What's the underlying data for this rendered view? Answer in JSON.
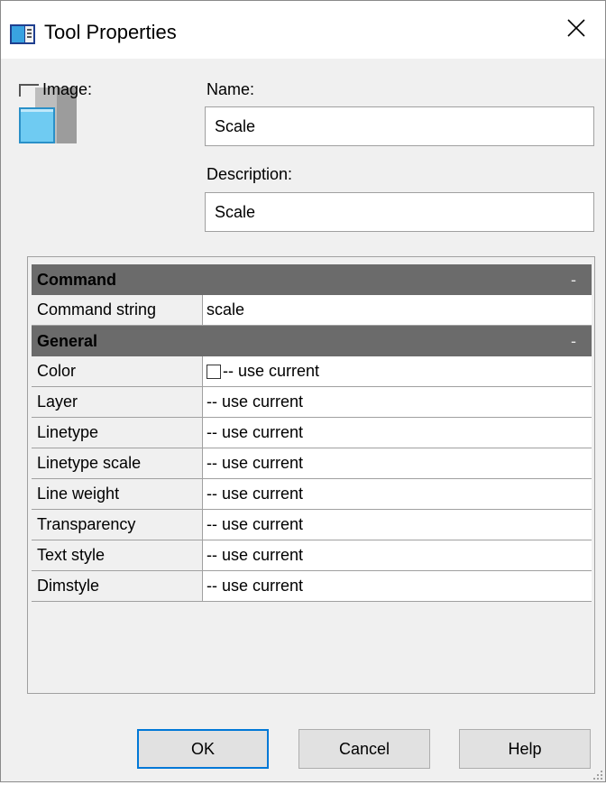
{
  "window": {
    "title": "Tool Properties"
  },
  "form": {
    "image_label": "Image:",
    "name_label": "Name:",
    "name_value": "Scale",
    "description_label": "Description:",
    "description_value": "Scale"
  },
  "grid": {
    "categories": [
      {
        "title": "Command",
        "toggle": "-",
        "rows": [
          {
            "name": "Command string",
            "value": "scale"
          }
        ]
      },
      {
        "title": "General",
        "toggle": "-",
        "rows": [
          {
            "name": "Color",
            "value": "-- use current"
          },
          {
            "name": "Layer",
            "value": "-- use current"
          },
          {
            "name": "Linetype",
            "value": "-- use current"
          },
          {
            "name": "Linetype scale",
            "value": "-- use current"
          },
          {
            "name": "Line weight",
            "value": "-- use current"
          },
          {
            "name": "Transparency",
            "value": "-- use current"
          },
          {
            "name": "Text style",
            "value": "-- use current"
          },
          {
            "name": "Dimstyle",
            "value": "-- use current"
          }
        ]
      }
    ]
  },
  "buttons": {
    "ok": "OK",
    "cancel": "Cancel",
    "help": "Help"
  },
  "icons": {
    "title": "tool-properties-icon",
    "close": "close-icon",
    "preview": "scale-tool-image",
    "color_swatch": "color-swatch-icon"
  },
  "colors": {
    "accent": "#0078d7",
    "category_header": "#6b6b6b",
    "dialog_bg": "#f0f0f0"
  }
}
